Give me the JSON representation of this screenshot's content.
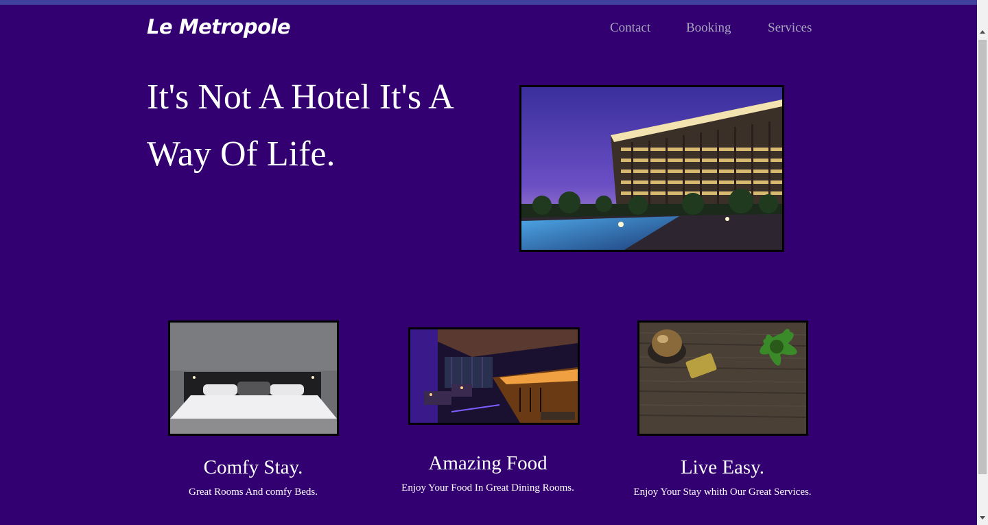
{
  "header": {
    "logo": "Le Metropole",
    "nav": [
      "Contact",
      "Booking",
      "Services"
    ]
  },
  "hero": {
    "title": "It's Not A Hotel It's A Way Of Life."
  },
  "features": [
    {
      "title": "Comfy Stay.",
      "text": "Great Rooms And comfy Beds."
    },
    {
      "title": "Amazing Food",
      "text": "Enjoy Your Food In Great Dining Rooms."
    },
    {
      "title": "Live Easy.",
      "text": "Enjoy Your Stay whith Our Great Services."
    }
  ],
  "colors": {
    "background": "#320070",
    "nav_text": "#a9a5c0",
    "topbar": "#3f3f9e"
  }
}
